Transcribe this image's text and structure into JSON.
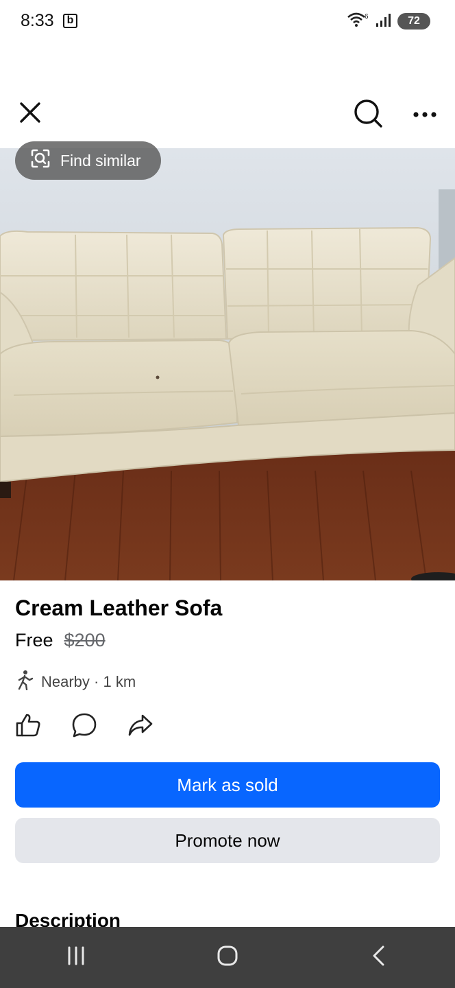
{
  "status_bar": {
    "time": "8:33",
    "app_badge": "b",
    "wifi_label": "6",
    "battery": "72"
  },
  "top_bar": {
    "close_icon": "close-icon",
    "search_icon": "search-icon",
    "more_icon": "more-horizontal-icon"
  },
  "photo": {
    "find_similar_label": "Find similar",
    "find_similar_icon": "visual-search-icon"
  },
  "listing": {
    "title": "Cream Leather Sofa",
    "price": "Free",
    "original_price": "$200",
    "location": "Nearby · 1 km"
  },
  "actions": {
    "like_icon": "thumbs-up-icon",
    "comment_icon": "comment-icon",
    "share_icon": "share-icon"
  },
  "buttons": {
    "mark_sold": "Mark as sold",
    "promote": "Promote now"
  },
  "description_heading": "Description",
  "colors": {
    "primary": "#0866ff",
    "secondary_button": "#e4e6eb",
    "nav_bar": "#3f3f3f"
  },
  "nav_bar": {
    "recent_icon": "recent-apps-icon",
    "home_icon": "home-icon",
    "back_icon": "back-icon"
  }
}
